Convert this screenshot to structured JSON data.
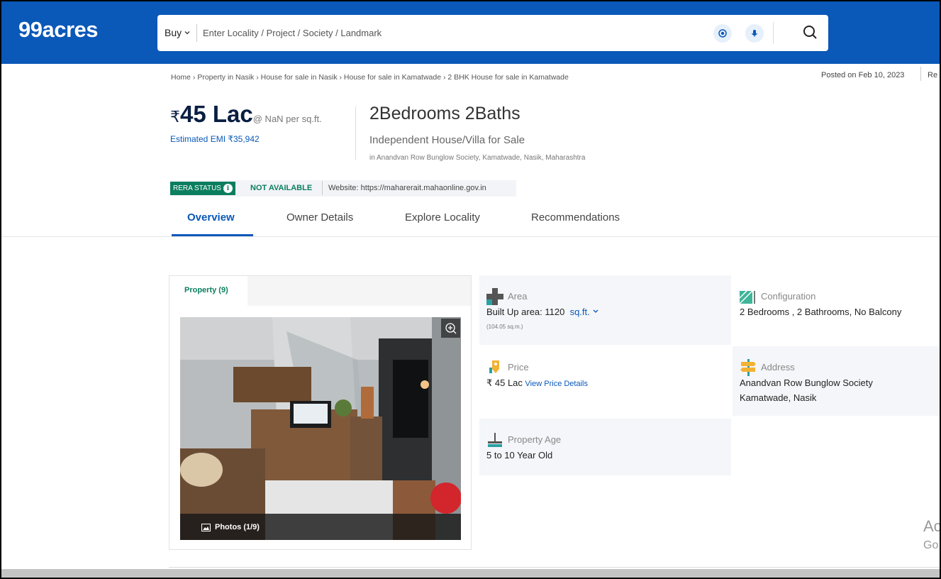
{
  "header": {
    "logo": "99acres",
    "buy_label": "Buy",
    "search_placeholder": "Enter Locality / Project / Society / Landmark"
  },
  "breadcrumb": "Home › Property in Nasik › House for sale in Nasik › House for sale in Kamatwade › 2 BHK House for sale in Kamatwade",
  "posted": "Posted on Feb 10, 2023",
  "report_partial": "Re",
  "price": {
    "currency": "₹",
    "amount": "45 Lac",
    "per_sqft": "@ NaN per sq.ft.",
    "emi": "Estimated EMI ₹35,942"
  },
  "property": {
    "title": "2Bedrooms 2Baths",
    "subtitle": "Independent House/Villa for Sale",
    "location": "in Anandvan Row Bunglow Society, Kamatwade, Nasik, Maharashtra"
  },
  "rera": {
    "label": "RERA STATUS",
    "status": "NOT AVAILABLE",
    "website": "Website: https://maharerait.mahaonline.gov.in"
  },
  "tabs": [
    "Overview",
    "Owner Details",
    "Explore Locality",
    "Recommendations"
  ],
  "gallery": {
    "tab": "Property (9)",
    "photo_count": "Photos (1/9)"
  },
  "details": {
    "area": {
      "label": "Area",
      "value": "Built Up area: 1120",
      "unit": "sq.ft.",
      "sub": "(104.05 sq.m.)"
    },
    "configuration": {
      "label": "Configuration",
      "value": "2 Bedrooms , 2 Bathrooms, No Balcony"
    },
    "price": {
      "label": "Price",
      "value": "₹ 45 Lac",
      "link": "View Price Details"
    },
    "address": {
      "label": "Address",
      "line1": "Anandvan Row Bunglow Society",
      "line2": "Kamatwade, Nasik"
    },
    "age": {
      "label": "Property Age",
      "value": "5 to 10 Year Old"
    }
  },
  "ad_partial": {
    "line1": "Ac",
    "line2": "Go"
  },
  "colors": {
    "brand_blue": "#0a58b8",
    "rera_green": "#0b7e5f"
  }
}
